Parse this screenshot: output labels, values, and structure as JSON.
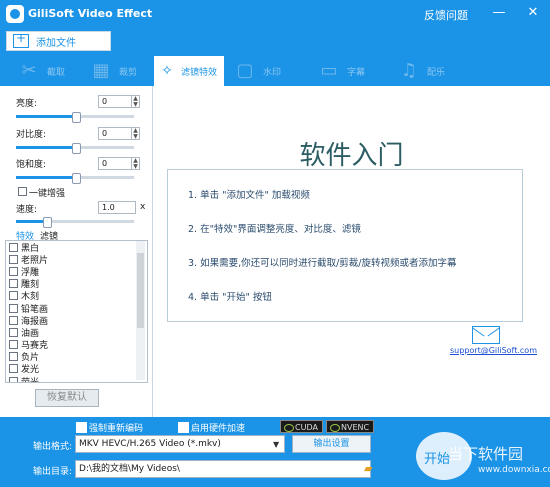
{
  "app": {
    "title": "GiliSoft Video Effect",
    "feedback": "反馈问题",
    "min": "—",
    "close": "✕"
  },
  "toolbar": {
    "add_file": "添加文件"
  },
  "tabs": [
    {
      "label": "截取",
      "icon": "cut-icon"
    },
    {
      "label": "裁剪",
      "icon": "crop-icon"
    },
    {
      "label": "滤镜特效",
      "icon": "magic-wand-icon"
    },
    {
      "label": "水印",
      "icon": "watermark-icon"
    },
    {
      "label": "字幕",
      "icon": "subtitle-icon"
    },
    {
      "label": "配乐",
      "icon": "music-icon"
    }
  ],
  "adjust": {
    "brightness": {
      "label": "亮度:",
      "value": "0",
      "level": 0.5
    },
    "contrast": {
      "label": "对比度:",
      "value": "0",
      "level": 0.5
    },
    "saturation": {
      "label": "饱和度:",
      "value": "0",
      "level": 0.5
    },
    "enhance": "一键增强",
    "speed": {
      "label": "速度:",
      "value": "1.0",
      "unit": "x",
      "level": 0.25
    }
  },
  "subtabs": {
    "effects": "特效",
    "filters": "滤镜"
  },
  "effects": [
    "黑白",
    "老照片",
    "浮雕",
    "雕刻",
    "木刻",
    "铅笔画",
    "海报画",
    "油画",
    "马赛克",
    "负片",
    "发光",
    "荧光"
  ],
  "reset": "恢复默认",
  "intro": {
    "title": "软件入门",
    "steps": [
      "1. 单击 \"添加文件\" 加载视频",
      "2. 在\"特效\"界面调整亮度、对比度、滤镜",
      "3. 如果需要,你还可以同时进行截取/剪裁/旋转视频或者添加字幕",
      "4. 单击 \"开始\" 按钮"
    ],
    "support": "support@GiliSoft.com"
  },
  "bottom": {
    "force_reencode": "强制重新编码",
    "hw_accel": "启用硬件加速",
    "cuda": "CUDA",
    "nvenc": "NVENC",
    "format_label": "输出格式:",
    "format_value": "MKV HEVC/H.265 Video (*.mkv)",
    "settings": "输出设置",
    "dir_label": "输出目录:",
    "dir_value": "D:\\我的文档\\My Videos\\",
    "start": "开始"
  },
  "watermark": {
    "text": "当下软件园",
    "url": "www.downxia.com"
  }
}
